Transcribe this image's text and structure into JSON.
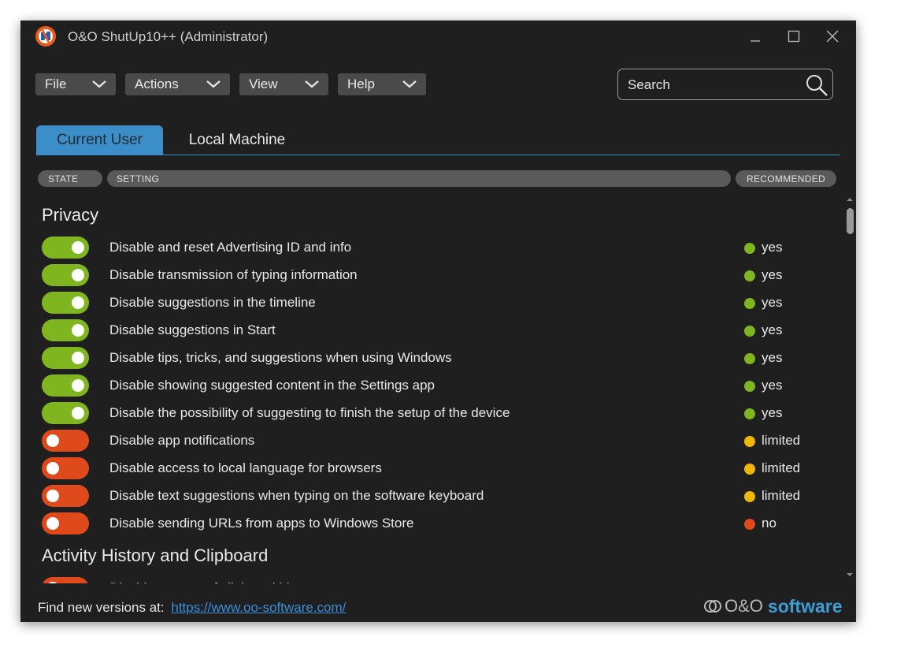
{
  "window": {
    "title": "O&O ShutUp10++ (Administrator)"
  },
  "menu": [
    {
      "label": "File"
    },
    {
      "label": "Actions"
    },
    {
      "label": "View"
    },
    {
      "label": "Help"
    }
  ],
  "search": {
    "placeholder": "Search"
  },
  "tabs": [
    {
      "label": "Current User",
      "active": true
    },
    {
      "label": "Local Machine",
      "active": false
    }
  ],
  "columns": {
    "state": "STATE",
    "setting": "SETTING",
    "recommended": "RECOMMENDED"
  },
  "colors": {
    "on": "#7fb51f",
    "off": "#df4a1c",
    "yes": "#7fb51f",
    "limited": "#f0b800",
    "no": "#df4a1c",
    "accent": "#3b8ec7"
  },
  "sections": [
    {
      "title": "Privacy",
      "rows": [
        {
          "state": "on",
          "label": "Disable and reset Advertising ID and info",
          "recommended": "yes"
        },
        {
          "state": "on",
          "label": "Disable transmission of typing information",
          "recommended": "yes"
        },
        {
          "state": "on",
          "label": "Disable suggestions in the timeline",
          "recommended": "yes"
        },
        {
          "state": "on",
          "label": "Disable suggestions in Start",
          "recommended": "yes"
        },
        {
          "state": "on",
          "label": "Disable tips, tricks, and suggestions when using Windows",
          "recommended": "yes"
        },
        {
          "state": "on",
          "label": "Disable showing suggested content in the Settings app",
          "recommended": "yes"
        },
        {
          "state": "on",
          "label": "Disable the possibility of suggesting to finish the setup of the device",
          "recommended": "yes"
        },
        {
          "state": "off",
          "label": "Disable app notifications",
          "recommended": "limited"
        },
        {
          "state": "off",
          "label": "Disable access to local language for browsers",
          "recommended": "limited"
        },
        {
          "state": "off",
          "label": "Disable text suggestions when typing on the software keyboard",
          "recommended": "limited"
        },
        {
          "state": "off",
          "label": "Disable sending URLs from apps to Windows Store",
          "recommended": "no"
        }
      ]
    },
    {
      "title": "Activity History and Clipboard",
      "rows": [
        {
          "state": "off",
          "label": "Disable storage of clipboard history",
          "recommended": "yes"
        }
      ]
    }
  ],
  "footer": {
    "text": "Find new versions at:",
    "link": "https://www.oo-software.com/",
    "brand_oo": "O&O",
    "brand_software": "software"
  }
}
